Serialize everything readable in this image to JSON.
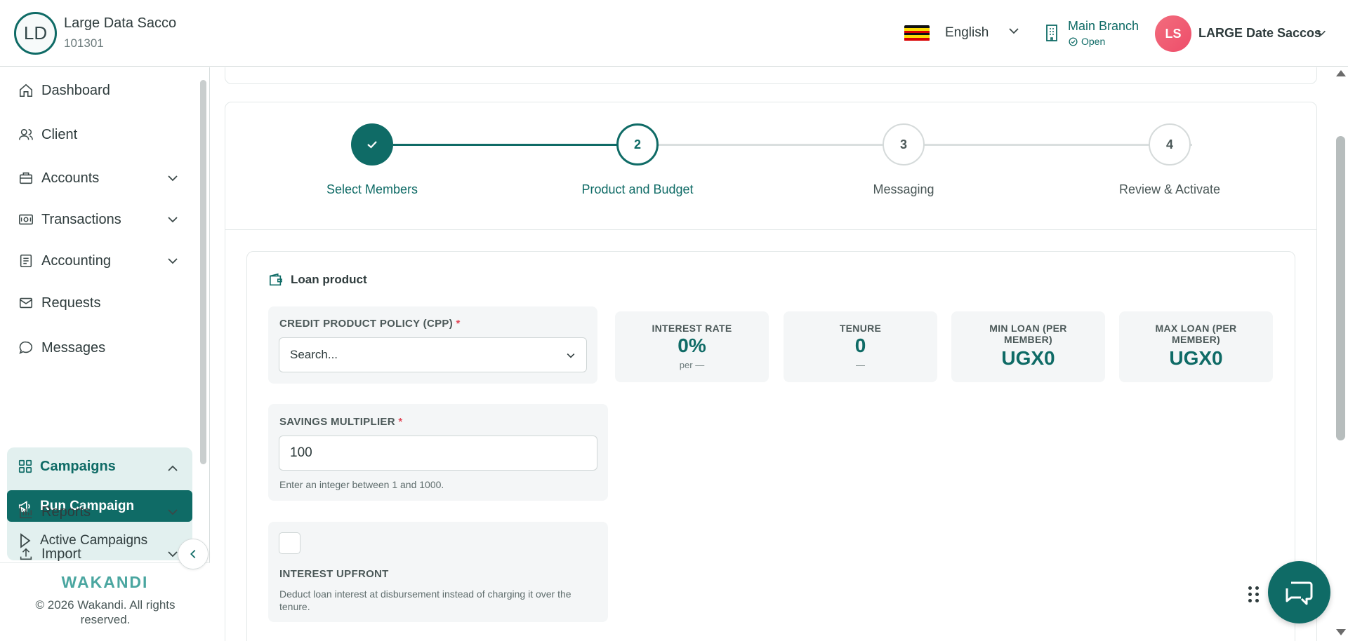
{
  "header": {
    "org_initials": "LD",
    "org_name": "Large Data Sacco",
    "org_id": "101301",
    "language": "English",
    "branch_name": "Main Branch",
    "branch_status": "Open",
    "user_initials": "LS",
    "user_name": "LARGE Date Saccos"
  },
  "sidebar": {
    "items": [
      {
        "label": "Dashboard",
        "icon": "home-icon"
      },
      {
        "label": "Client",
        "icon": "users-icon"
      },
      {
        "label": "Accounts",
        "icon": "briefcase-icon"
      },
      {
        "label": "Transactions",
        "icon": "money-icon"
      },
      {
        "label": "Accounting",
        "icon": "ledger-icon"
      },
      {
        "label": "Requests",
        "icon": "mail-icon"
      },
      {
        "label": "Messages",
        "icon": "chat-icon"
      }
    ],
    "campaigns": {
      "label": "Campaigns",
      "run_campaign": "Run Campaign",
      "active_campaigns": "Active Campaigns"
    },
    "reports": "Reports",
    "import": "Import",
    "brand": "WAKANDI",
    "copyright": "© 2026 Wakandi. All rights reserved."
  },
  "stepper": {
    "steps": [
      {
        "number": "✓",
        "label": "Select Members",
        "state": "done"
      },
      {
        "number": "2",
        "label": "Product and Budget",
        "state": "current"
      },
      {
        "number": "3",
        "label": "Messaging",
        "state": "pending"
      },
      {
        "number": "4",
        "label": "Review & Activate",
        "state": "pending"
      }
    ]
  },
  "loan_product": {
    "title": "Loan product",
    "cpp_label": "CREDIT PRODUCT POLICY (CPP)",
    "required_mark": "*",
    "cpp_placeholder": "Search...",
    "stats": {
      "interest_rate": {
        "label": "INTEREST RATE",
        "value": "0%",
        "sub": "per —"
      },
      "tenure": {
        "label": "TENURE",
        "value": "0",
        "sub": "—"
      },
      "min_loan": {
        "label": "MIN LOAN (PER MEMBER)",
        "value": "UGX0"
      },
      "max_loan": {
        "label": "MAX LOAN (PER MEMBER)",
        "value": "UGX0"
      }
    },
    "savings_multiplier_label": "SAVINGS MULTIPLIER",
    "savings_multiplier_value": "100",
    "savings_multiplier_hint": "Enter an integer between 1 and 1000.",
    "interest_upfront_label": "INTEREST UPFRONT",
    "interest_upfront_checked": false,
    "interest_upfront_hint": "Deduct loan interest at disbursement instead of charging it over the tenure."
  },
  "colors": {
    "primary": "#0f6b66",
    "campaign_bg": "#e2f0ef",
    "required": "#e14a5a",
    "avatar": "#ee4d6a"
  }
}
